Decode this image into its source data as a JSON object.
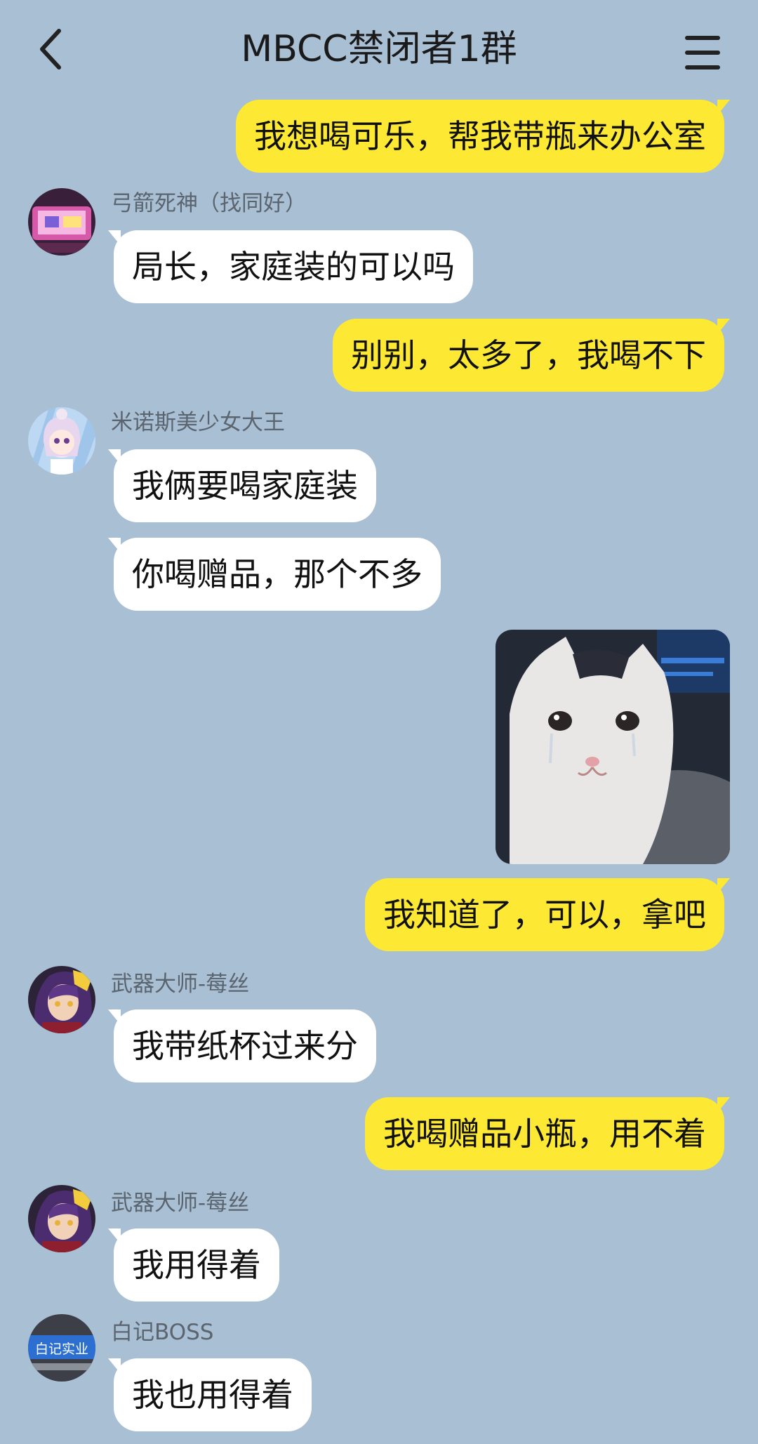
{
  "header": {
    "title": "MBCC禁闭者1群"
  },
  "messages": [
    {
      "side": "out",
      "text": "我想喝可乐，帮我带瓶来办公室"
    },
    {
      "side": "in",
      "sender": "弓箭死神（找同好）",
      "text": "局长，家庭装的可以吗"
    },
    {
      "side": "out",
      "text": "别别，太多了，我喝不下"
    },
    {
      "side": "in",
      "sender": "米诺斯美少女大王",
      "text": "我俩要喝家庭装"
    },
    {
      "side": "in",
      "text": "你喝赠品，那个不多"
    },
    {
      "side": "out",
      "type": "image",
      "image": "crying-cat-sticker"
    },
    {
      "side": "out",
      "text": "我知道了，可以，拿吧"
    },
    {
      "side": "in",
      "sender": "武器大师-莓丝",
      "text": "我带纸杯过来分"
    },
    {
      "side": "out",
      "text": "我喝赠品小瓶，用不着"
    },
    {
      "side": "in",
      "sender": "武器大师-莓丝",
      "text": "我用得着"
    },
    {
      "side": "in",
      "sender": "白记BOSS",
      "avatar_text": "白记实业",
      "text": "我也用得着"
    }
  ],
  "icons": {
    "back": "chevron-left-icon",
    "menu": "hamburger-menu-icon"
  },
  "colors": {
    "background": "#a9bfd3",
    "outgoing_bubble": "#fde933",
    "incoming_bubble": "#ffffff"
  }
}
